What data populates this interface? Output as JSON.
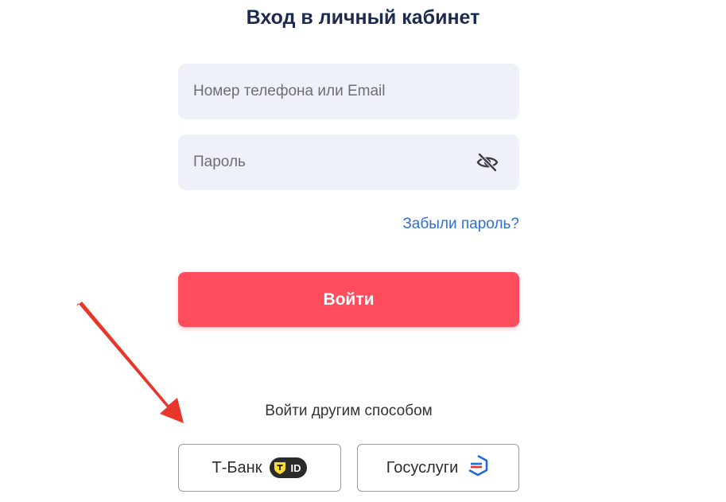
{
  "page": {
    "title": "Вход в личный кабинет"
  },
  "form": {
    "login_placeholder": "Номер телефона или Email",
    "password_placeholder": "Пароль",
    "forgot_link": "Забыли пароль?",
    "submit_label": "Войти"
  },
  "alternative_login": {
    "caption": "Войти другим способом",
    "tbank_label": "Т-Банк",
    "tbank_badge": "ID",
    "gosuslugi_label": "Госуслуги"
  },
  "icons": {
    "password_toggle": "eye-off-icon",
    "tbank_id": "t-id-badge-icon",
    "gosuslugi": "gosuslugi-logo-icon",
    "annotation": "red-arrow"
  },
  "colors": {
    "title": "#1d2a4f",
    "field_bg": "#eef1f8",
    "link": "#2f6ed8",
    "primary_button": "#ff4d5e",
    "annotation_arrow": "#e8372a"
  }
}
